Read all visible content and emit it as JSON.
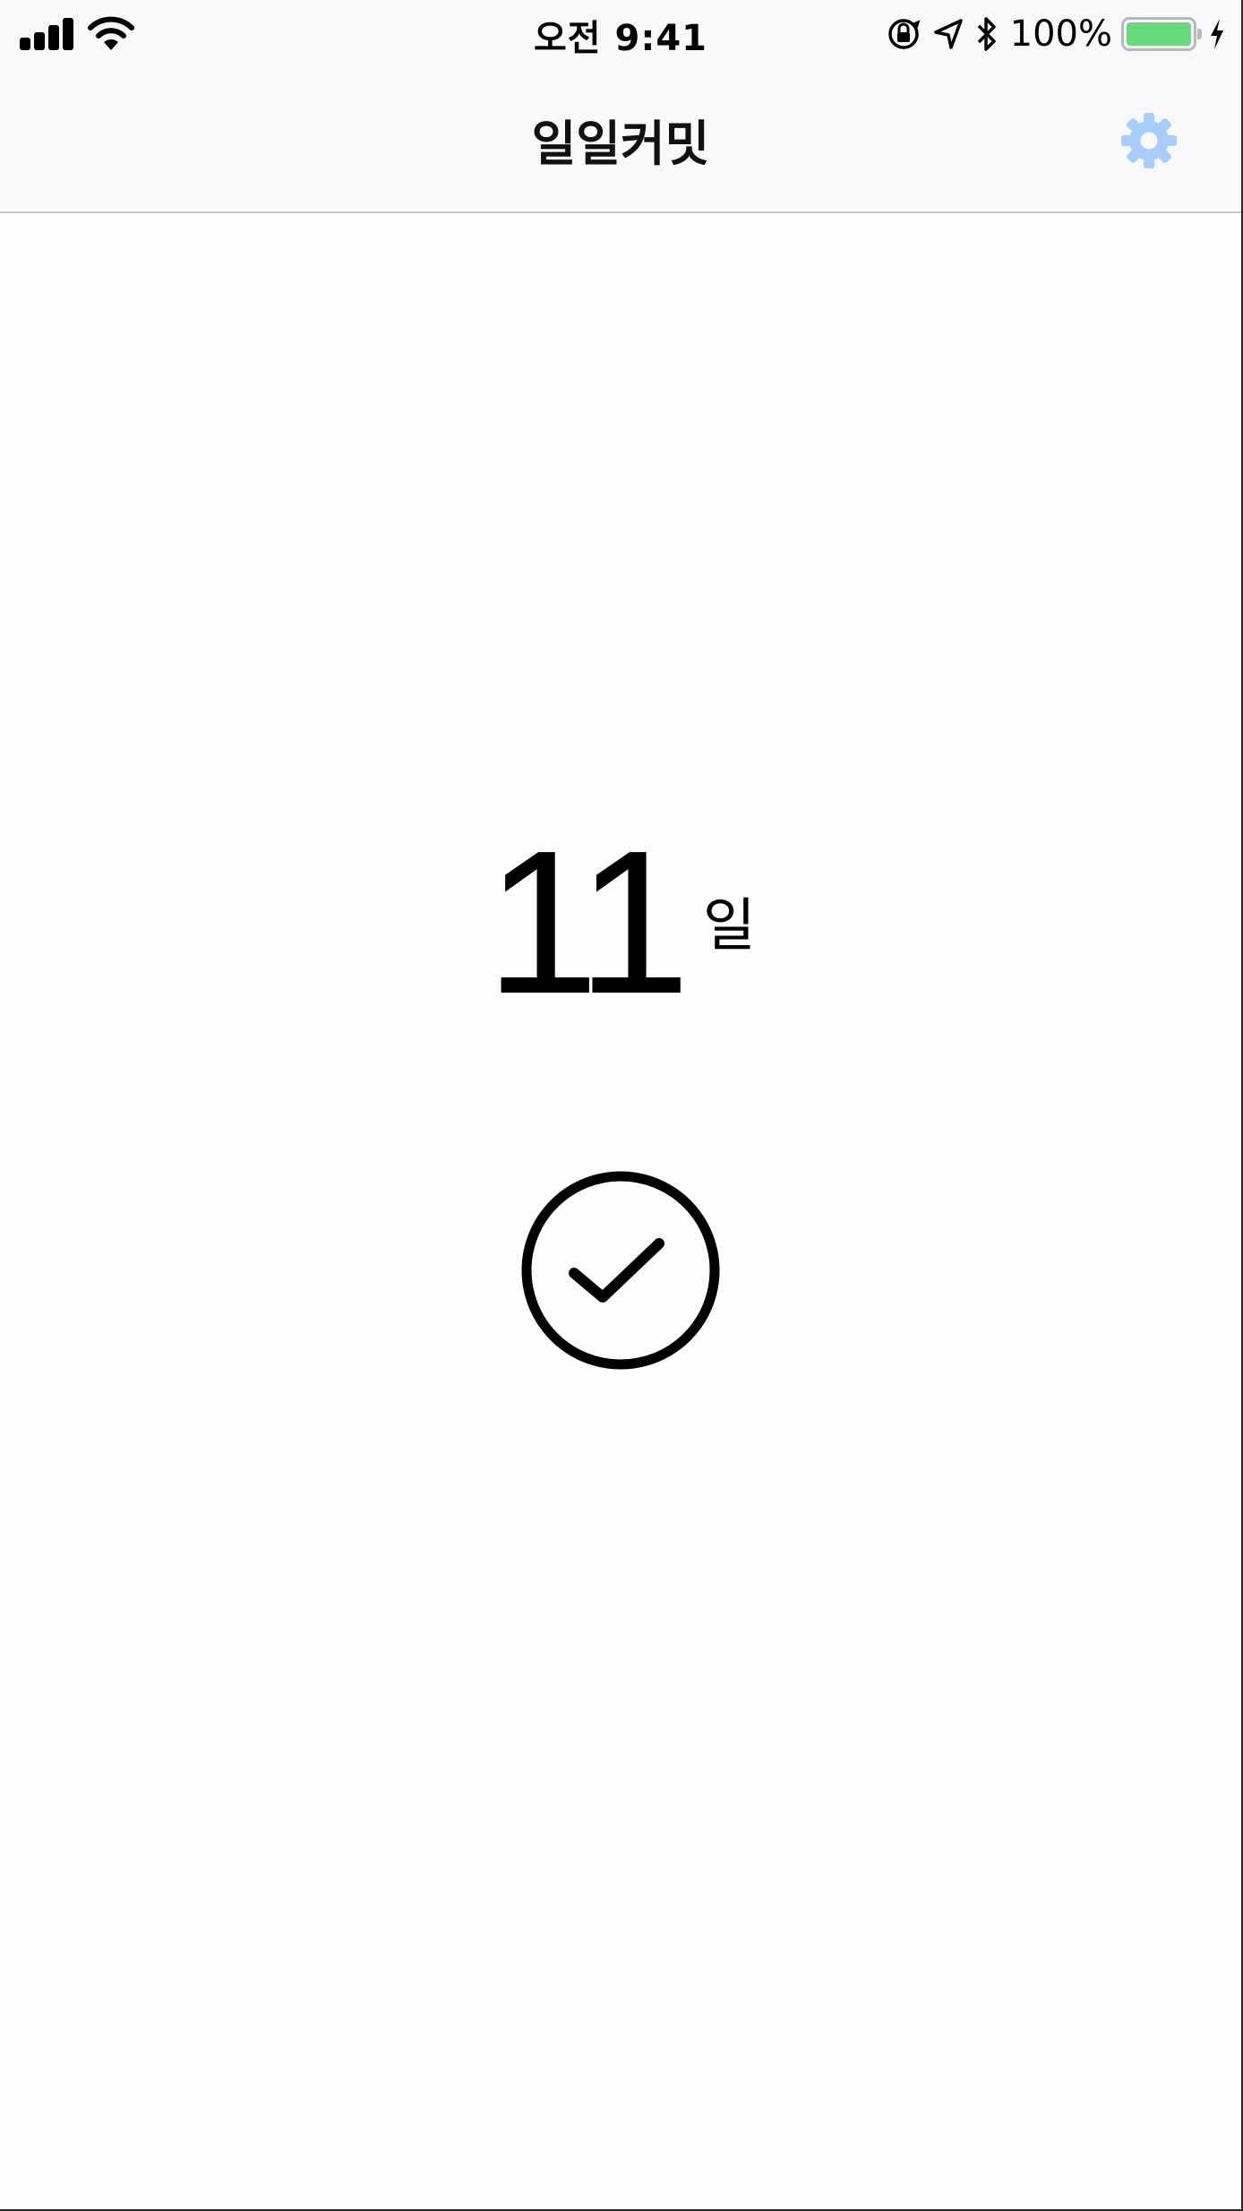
{
  "status_bar": {
    "time": "오전 9:41",
    "battery_percent": "100%",
    "battery_level": 1.0,
    "signal_bars": 4,
    "icons": [
      "signal-icon",
      "wifi-icon",
      "orientation-lock-icon",
      "location-icon",
      "bluetooth-icon",
      "battery-icon",
      "charging-icon"
    ]
  },
  "nav": {
    "title": "일일커밋",
    "settings_icon": "gear-icon"
  },
  "main": {
    "day_count": "11",
    "day_unit": "일",
    "check_icon": "check-circle-icon"
  },
  "colors": {
    "accent": "#a6cdfb",
    "bar_background": "#f9f8fa",
    "battery_fill": "#67da7d",
    "text": "#000000"
  }
}
